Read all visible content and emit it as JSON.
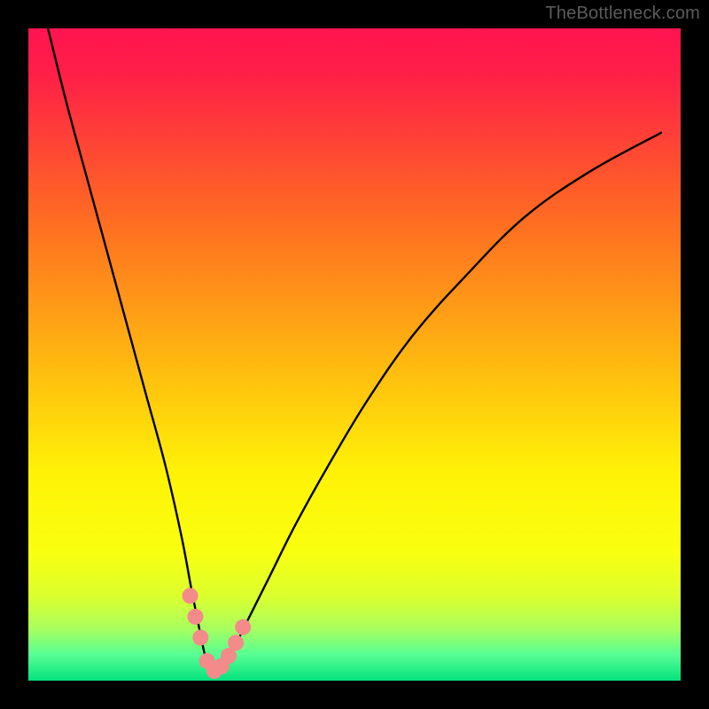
{
  "attribution": "TheBottleneck.com",
  "chart_data": {
    "type": "line",
    "title": "",
    "xlabel": "",
    "ylabel": "",
    "xlim": [
      0,
      100
    ],
    "ylim": [
      0,
      100
    ],
    "grid": false,
    "legend": false,
    "gradient_bands": [
      {
        "pos": 0.0,
        "color": "#ff1450"
      },
      {
        "pos": 0.07,
        "color": "#ff1f47"
      },
      {
        "pos": 0.3,
        "color": "#ff6e21"
      },
      {
        "pos": 0.5,
        "color": "#ffb411"
      },
      {
        "pos": 0.68,
        "color": "#fff207"
      },
      {
        "pos": 0.8,
        "color": "#faff0f"
      },
      {
        "pos": 0.87,
        "color": "#dcff2e"
      },
      {
        "pos": 0.92,
        "color": "#a9ff5e"
      },
      {
        "pos": 0.96,
        "color": "#57ff94"
      },
      {
        "pos": 1.0,
        "color": "#05e27e"
      }
    ],
    "series": [
      {
        "name": "bottleneck-curve",
        "color": "#000000",
        "x": [
          3,
          6,
          9,
          12,
          15,
          18,
          21,
          23.5,
          25,
          26.2,
          27,
          27.6,
          28.2,
          28.8,
          29.6,
          30.6,
          32,
          34,
          37,
          41,
          46,
          52,
          59,
          67,
          76,
          86,
          97
        ],
        "y": [
          100,
          88,
          77,
          66,
          55,
          44,
          33,
          22,
          14,
          8,
          4.2,
          2.4,
          1.5,
          1.5,
          2.1,
          3.6,
          6,
          10,
          16,
          24,
          33,
          43,
          53,
          62,
          71,
          78,
          84
        ]
      }
    ],
    "markers": {
      "name": "highlight-points",
      "color": "#f48a8a",
      "points": [
        {
          "x": 24.8,
          "y": 13.0
        },
        {
          "x": 25.6,
          "y": 9.8
        },
        {
          "x": 26.4,
          "y": 6.6
        },
        {
          "x": 27.4,
          "y": 3.0
        },
        {
          "x": 28.5,
          "y": 1.5
        },
        {
          "x": 29.6,
          "y": 2.2
        },
        {
          "x": 30.7,
          "y": 3.8
        },
        {
          "x": 31.8,
          "y": 5.8
        },
        {
          "x": 32.9,
          "y": 8.2
        }
      ]
    }
  }
}
